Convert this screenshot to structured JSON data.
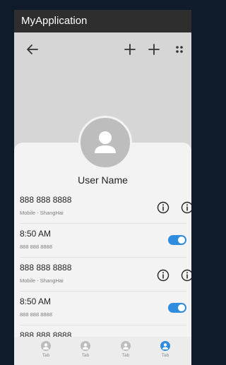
{
  "app": {
    "title": "MyApplication"
  },
  "toolbar": {
    "back_icon": "arrow-left-icon",
    "add_icon": "plus-icon",
    "more_icon": "grid-dots-icon"
  },
  "profile": {
    "username": "User Name"
  },
  "colors": {
    "accent": "#2f8be0",
    "titlebar": "#2e2e2e",
    "header": "#d6d6d6"
  },
  "list": [
    {
      "title": "888 888 8888",
      "subtitle": "Mobile - ShangHai",
      "type": "info"
    },
    {
      "title": "8:50 AM",
      "subtitle": "888 888 8888",
      "type": "toggle",
      "on": true
    },
    {
      "title": "888 888 8888",
      "subtitle": "Mobile - ShangHai",
      "type": "info"
    },
    {
      "title": "8:50 AM",
      "subtitle": "888 888 8888",
      "type": "toggle",
      "on": true
    },
    {
      "title": "888 888 8888",
      "subtitle": "",
      "type": "info"
    }
  ],
  "tabs": [
    {
      "label": "Tab",
      "active": false
    },
    {
      "label": "Tab",
      "active": false
    },
    {
      "label": "Tab",
      "active": false
    },
    {
      "label": "Tab",
      "active": true
    }
  ]
}
